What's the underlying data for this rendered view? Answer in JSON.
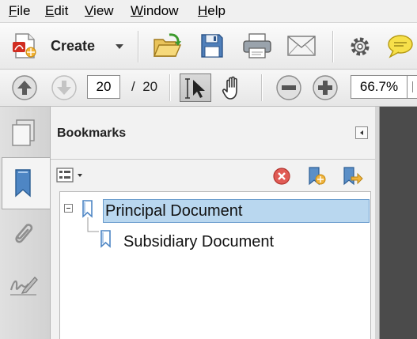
{
  "menu": {
    "items": [
      {
        "label": "File",
        "key": "F",
        "rest": "ile"
      },
      {
        "label": "Edit",
        "key": "E",
        "rest": "dit"
      },
      {
        "label": "View",
        "key": "V",
        "rest": "iew"
      },
      {
        "label": "Window",
        "key": "W",
        "rest": "indow"
      },
      {
        "label": "Help",
        "key": "H",
        "rest": "elp"
      }
    ]
  },
  "toolbar": {
    "create_label": "Create",
    "icons": [
      "create-pdf-icon",
      "open-folder-icon",
      "save-icon",
      "print-icon",
      "email-icon",
      "gear-icon",
      "comment-icon"
    ]
  },
  "navigation": {
    "page_current": "20",
    "page_separator": "/",
    "page_total": "20",
    "zoom_value": "66.7%",
    "icons": [
      "previous-page-icon",
      "next-page-icon",
      "select-tool-icon",
      "hand-tool-icon",
      "zoom-out-icon",
      "zoom-in-icon"
    ]
  },
  "bookmarks_panel": {
    "title": "Bookmarks",
    "items": [
      {
        "label": "Principal Document",
        "selected": true,
        "level": 0
      },
      {
        "label": "Subsidiary Document",
        "selected": false,
        "level": 1
      }
    ]
  },
  "colors": {
    "selection_fill": "#b9d7ef",
    "selection_border": "#6a9ccd",
    "bookmark_icon": "#5b8fc7",
    "document_bg": "#4b4b4b"
  }
}
